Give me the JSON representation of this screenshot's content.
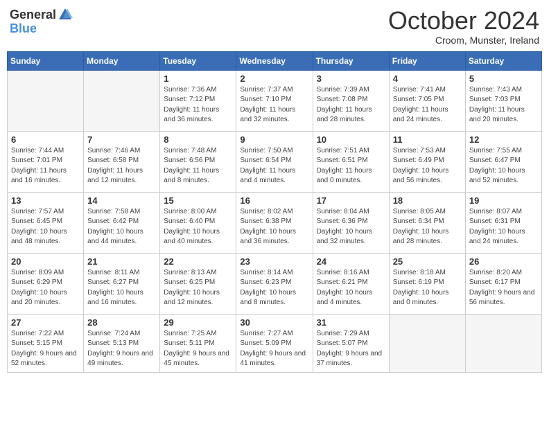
{
  "header": {
    "logo_general": "General",
    "logo_blue": "Blue",
    "month_title": "October 2024",
    "location": "Croom, Munster, Ireland"
  },
  "days_of_week": [
    "Sunday",
    "Monday",
    "Tuesday",
    "Wednesday",
    "Thursday",
    "Friday",
    "Saturday"
  ],
  "weeks": [
    [
      {
        "day": "",
        "empty": true
      },
      {
        "day": "",
        "empty": true
      },
      {
        "day": "1",
        "sunrise": "Sunrise: 7:36 AM",
        "sunset": "Sunset: 7:12 PM",
        "daylight": "Daylight: 11 hours and 36 minutes."
      },
      {
        "day": "2",
        "sunrise": "Sunrise: 7:37 AM",
        "sunset": "Sunset: 7:10 PM",
        "daylight": "Daylight: 11 hours and 32 minutes."
      },
      {
        "day": "3",
        "sunrise": "Sunrise: 7:39 AM",
        "sunset": "Sunset: 7:08 PM",
        "daylight": "Daylight: 11 hours and 28 minutes."
      },
      {
        "day": "4",
        "sunrise": "Sunrise: 7:41 AM",
        "sunset": "Sunset: 7:05 PM",
        "daylight": "Daylight: 11 hours and 24 minutes."
      },
      {
        "day": "5",
        "sunrise": "Sunrise: 7:43 AM",
        "sunset": "Sunset: 7:03 PM",
        "daylight": "Daylight: 11 hours and 20 minutes."
      }
    ],
    [
      {
        "day": "6",
        "sunrise": "Sunrise: 7:44 AM",
        "sunset": "Sunset: 7:01 PM",
        "daylight": "Daylight: 11 hours and 16 minutes."
      },
      {
        "day": "7",
        "sunrise": "Sunrise: 7:46 AM",
        "sunset": "Sunset: 6:58 PM",
        "daylight": "Daylight: 11 hours and 12 minutes."
      },
      {
        "day": "8",
        "sunrise": "Sunrise: 7:48 AM",
        "sunset": "Sunset: 6:56 PM",
        "daylight": "Daylight: 11 hours and 8 minutes."
      },
      {
        "day": "9",
        "sunrise": "Sunrise: 7:50 AM",
        "sunset": "Sunset: 6:54 PM",
        "daylight": "Daylight: 11 hours and 4 minutes."
      },
      {
        "day": "10",
        "sunrise": "Sunrise: 7:51 AM",
        "sunset": "Sunset: 6:51 PM",
        "daylight": "Daylight: 11 hours and 0 minutes."
      },
      {
        "day": "11",
        "sunrise": "Sunrise: 7:53 AM",
        "sunset": "Sunset: 6:49 PM",
        "daylight": "Daylight: 10 hours and 56 minutes."
      },
      {
        "day": "12",
        "sunrise": "Sunrise: 7:55 AM",
        "sunset": "Sunset: 6:47 PM",
        "daylight": "Daylight: 10 hours and 52 minutes."
      }
    ],
    [
      {
        "day": "13",
        "sunrise": "Sunrise: 7:57 AM",
        "sunset": "Sunset: 6:45 PM",
        "daylight": "Daylight: 10 hours and 48 minutes."
      },
      {
        "day": "14",
        "sunrise": "Sunrise: 7:58 AM",
        "sunset": "Sunset: 6:42 PM",
        "daylight": "Daylight: 10 hours and 44 minutes."
      },
      {
        "day": "15",
        "sunrise": "Sunrise: 8:00 AM",
        "sunset": "Sunset: 6:40 PM",
        "daylight": "Daylight: 10 hours and 40 minutes."
      },
      {
        "day": "16",
        "sunrise": "Sunrise: 8:02 AM",
        "sunset": "Sunset: 6:38 PM",
        "daylight": "Daylight: 10 hours and 36 minutes."
      },
      {
        "day": "17",
        "sunrise": "Sunrise: 8:04 AM",
        "sunset": "Sunset: 6:36 PM",
        "daylight": "Daylight: 10 hours and 32 minutes."
      },
      {
        "day": "18",
        "sunrise": "Sunrise: 8:05 AM",
        "sunset": "Sunset: 6:34 PM",
        "daylight": "Daylight: 10 hours and 28 minutes."
      },
      {
        "day": "19",
        "sunrise": "Sunrise: 8:07 AM",
        "sunset": "Sunset: 6:31 PM",
        "daylight": "Daylight: 10 hours and 24 minutes."
      }
    ],
    [
      {
        "day": "20",
        "sunrise": "Sunrise: 8:09 AM",
        "sunset": "Sunset: 6:29 PM",
        "daylight": "Daylight: 10 hours and 20 minutes."
      },
      {
        "day": "21",
        "sunrise": "Sunrise: 8:11 AM",
        "sunset": "Sunset: 6:27 PM",
        "daylight": "Daylight: 10 hours and 16 minutes."
      },
      {
        "day": "22",
        "sunrise": "Sunrise: 8:13 AM",
        "sunset": "Sunset: 6:25 PM",
        "daylight": "Daylight: 10 hours and 12 minutes."
      },
      {
        "day": "23",
        "sunrise": "Sunrise: 8:14 AM",
        "sunset": "Sunset: 6:23 PM",
        "daylight": "Daylight: 10 hours and 8 minutes."
      },
      {
        "day": "24",
        "sunrise": "Sunrise: 8:16 AM",
        "sunset": "Sunset: 6:21 PM",
        "daylight": "Daylight: 10 hours and 4 minutes."
      },
      {
        "day": "25",
        "sunrise": "Sunrise: 8:18 AM",
        "sunset": "Sunset: 6:19 PM",
        "daylight": "Daylight: 10 hours and 0 minutes."
      },
      {
        "day": "26",
        "sunrise": "Sunrise: 8:20 AM",
        "sunset": "Sunset: 6:17 PM",
        "daylight": "Daylight: 9 hours and 56 minutes."
      }
    ],
    [
      {
        "day": "27",
        "sunrise": "Sunrise: 7:22 AM",
        "sunset": "Sunset: 5:15 PM",
        "daylight": "Daylight: 9 hours and 52 minutes."
      },
      {
        "day": "28",
        "sunrise": "Sunrise: 7:24 AM",
        "sunset": "Sunset: 5:13 PM",
        "daylight": "Daylight: 9 hours and 49 minutes."
      },
      {
        "day": "29",
        "sunrise": "Sunrise: 7:25 AM",
        "sunset": "Sunset: 5:11 PM",
        "daylight": "Daylight: 9 hours and 45 minutes."
      },
      {
        "day": "30",
        "sunrise": "Sunrise: 7:27 AM",
        "sunset": "Sunset: 5:09 PM",
        "daylight": "Daylight: 9 hours and 41 minutes."
      },
      {
        "day": "31",
        "sunrise": "Sunrise: 7:29 AM",
        "sunset": "Sunset: 5:07 PM",
        "daylight": "Daylight: 9 hours and 37 minutes."
      },
      {
        "day": "",
        "empty": true
      },
      {
        "day": "",
        "empty": true
      }
    ]
  ]
}
